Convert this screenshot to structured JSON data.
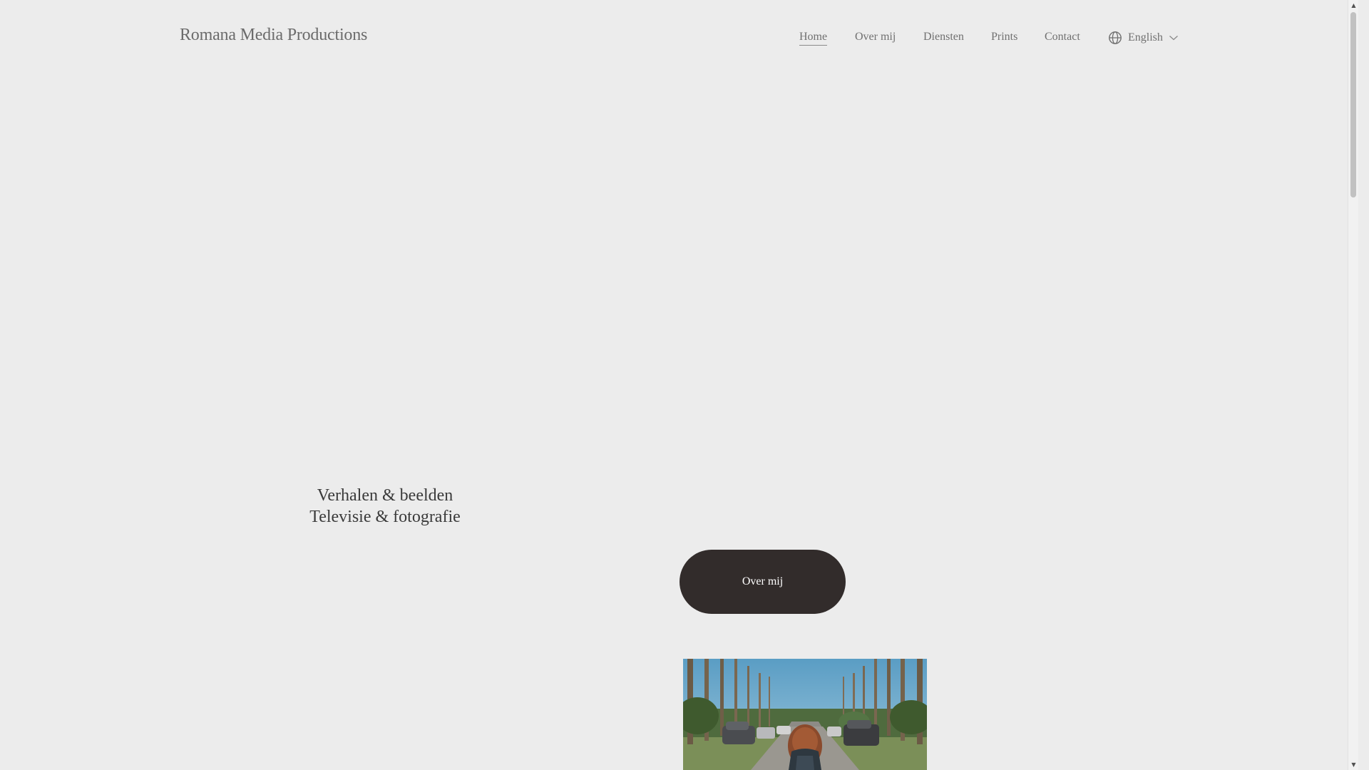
{
  "header": {
    "site_title": "Romana Media Productions",
    "nav": [
      {
        "label": "Home",
        "active": true
      },
      {
        "label": "Over mij",
        "active": false
      },
      {
        "label": "Diensten",
        "active": false
      },
      {
        "label": "Prints",
        "active": false
      },
      {
        "label": "Contact",
        "active": false
      }
    ],
    "language": {
      "label": "English",
      "icon": "globe-icon",
      "chevron": "chevron-down-icon"
    }
  },
  "hero": {
    "line1": "Verhalen & beelden",
    "line2": "Televisie & fotografie",
    "cta_label": "Over mij"
  },
  "colors": {
    "background": "#ececec",
    "text": "#707070",
    "button": "#322c2b",
    "button_text": "#ffffff"
  }
}
